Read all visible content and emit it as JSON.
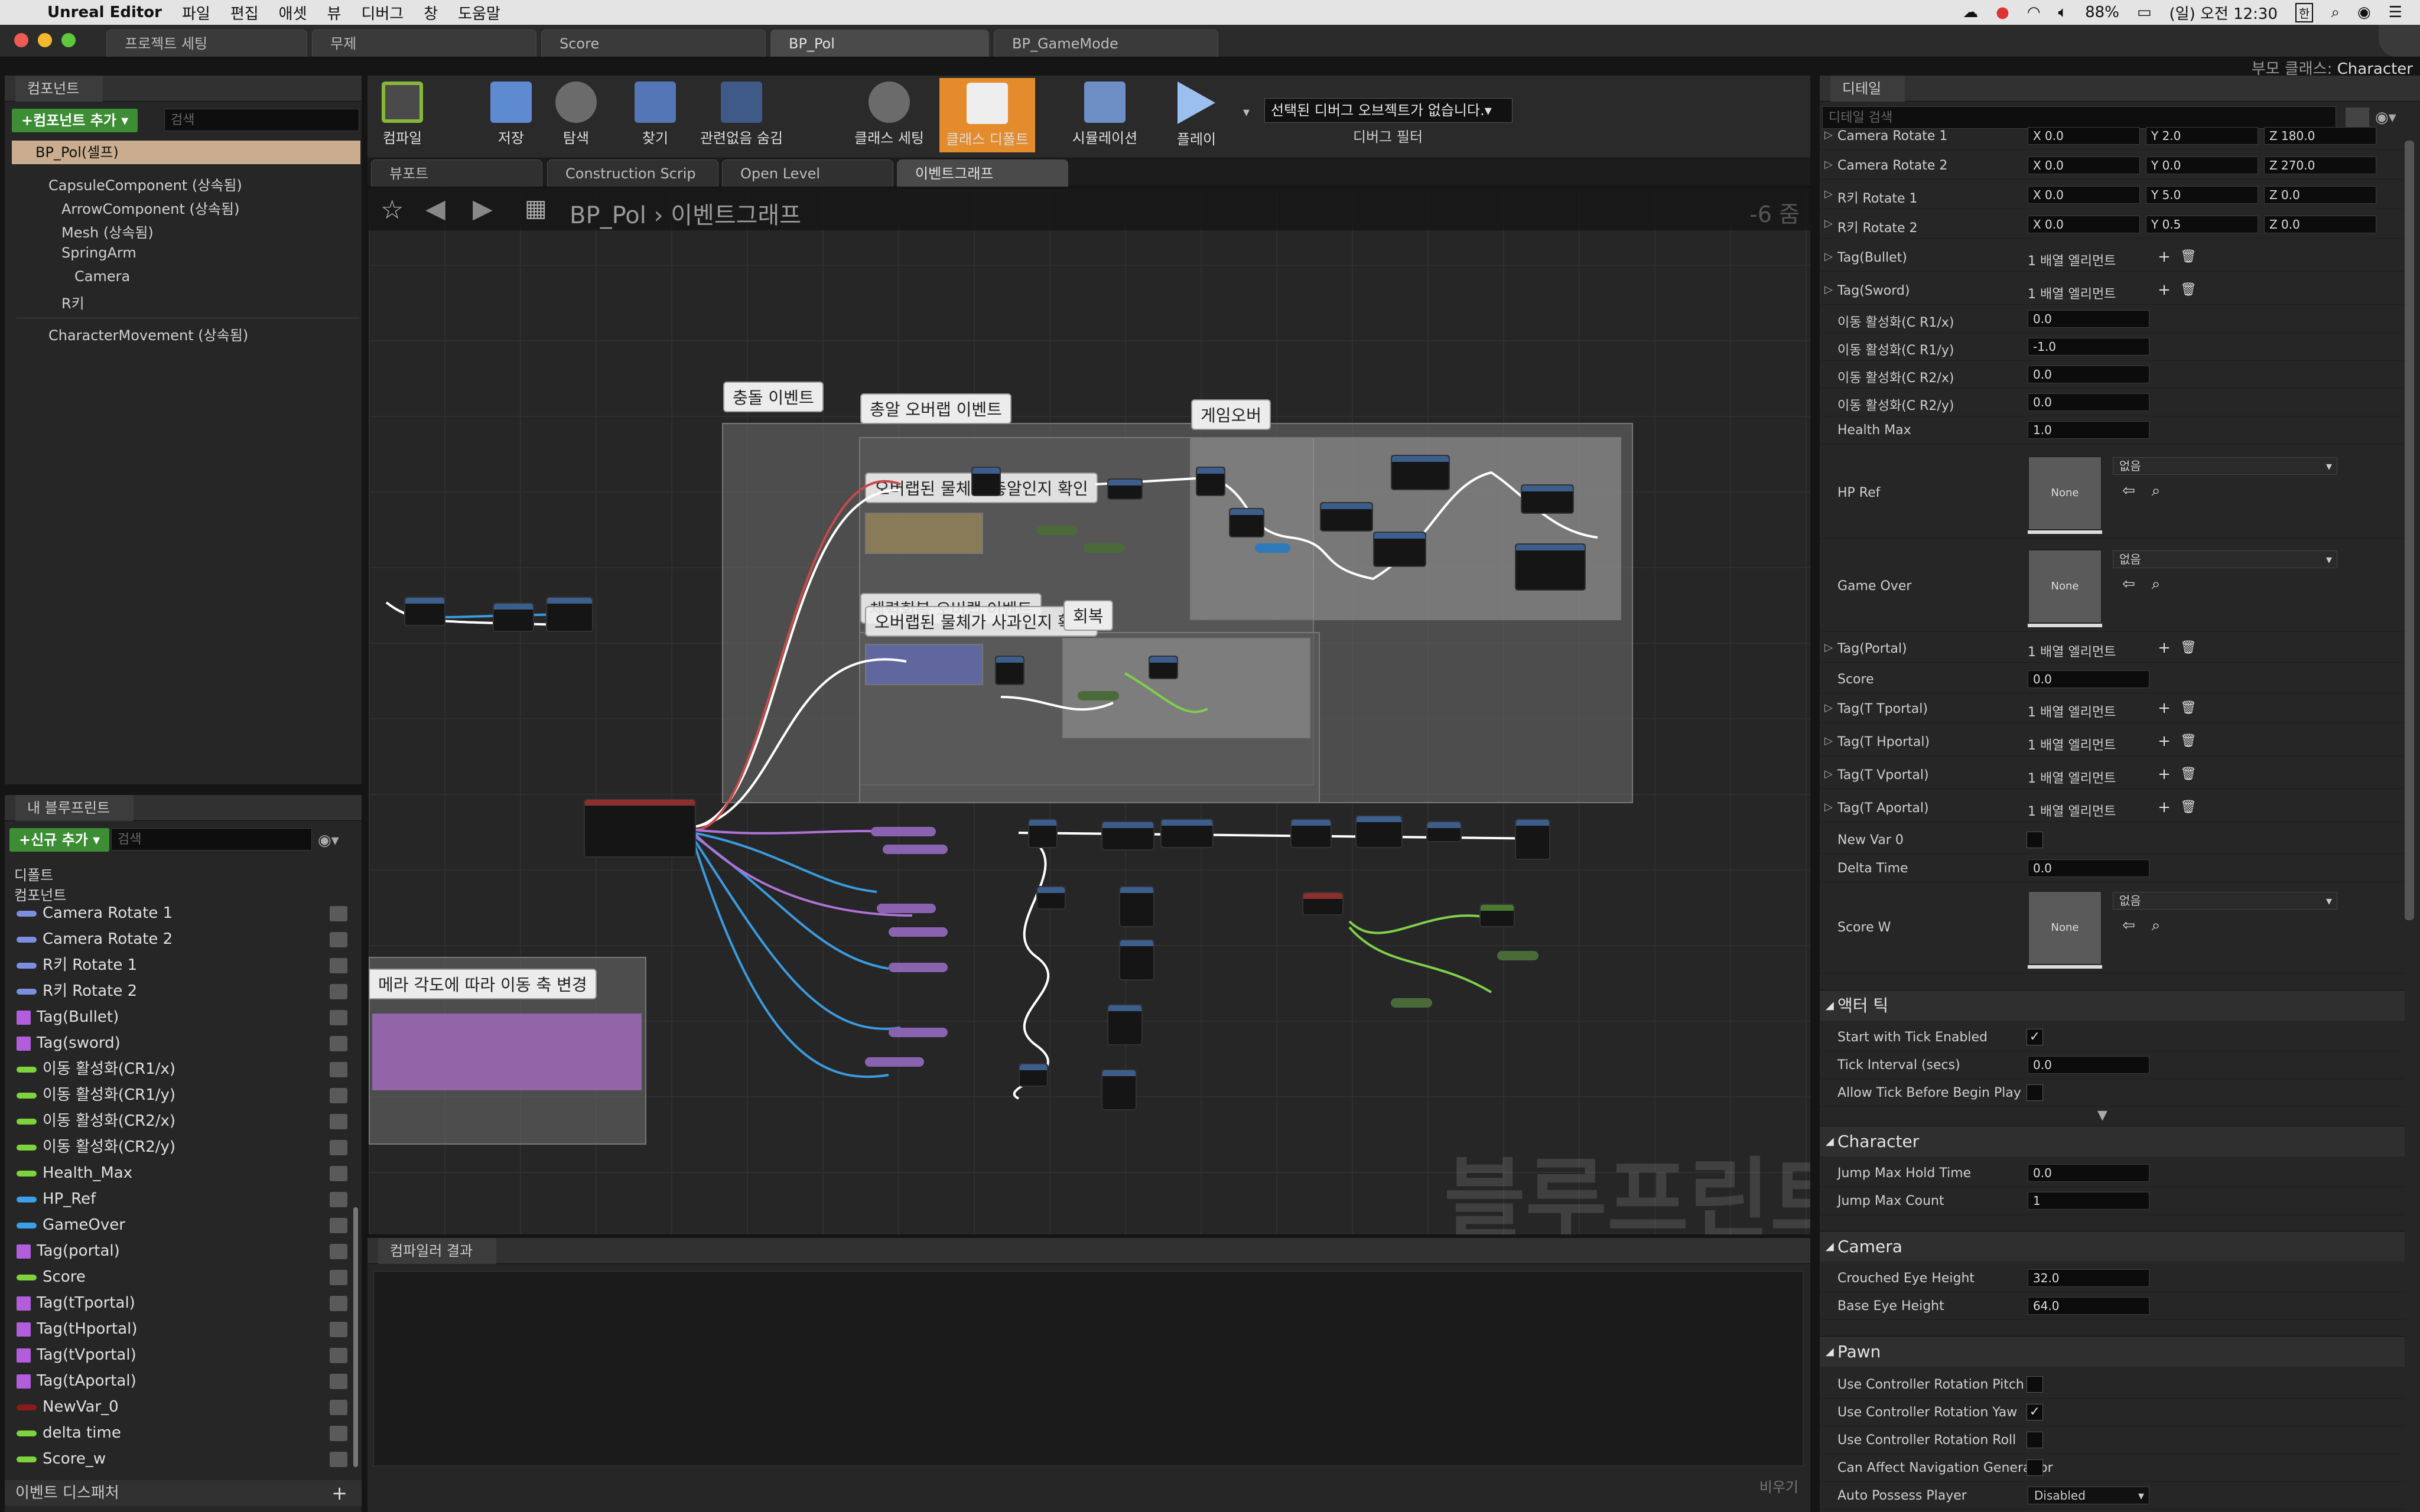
{
  "menubar": {
    "app": "Unreal Editor",
    "menus": [
      "파일",
      "편집",
      "애셋",
      "뷰",
      "디버그",
      "창",
      "도움말"
    ],
    "battery": "88%",
    "clock": "(일) 오전 12:30",
    "ime": "한"
  },
  "tabs": [
    "프로젝트 세팅",
    "무제",
    "Score",
    "BP_Pol",
    "BP_GameMode"
  ],
  "parent_class": {
    "label": "부모 클래스:",
    "value": "Character"
  },
  "components": {
    "title": "컴포넌트",
    "add": "+컴포넌트 추가 ▾",
    "search_placeholder": "검색",
    "root": "BP_Pol(셀프)",
    "items": [
      "CapsuleComponent (상속됨)",
      "ArrowComponent (상속됨)",
      "Mesh (상속됨)",
      "SpringArm",
      "Camera",
      "R키",
      "CharacterMovement (상속됨)"
    ]
  },
  "myblueprint": {
    "title": "내 블루프린트",
    "add": "+신규 추가 ▾",
    "search_placeholder": "검색",
    "sec_default": "디폴트",
    "sec_components": "컴포넌트",
    "vars": [
      {
        "name": "Camera Rotate 1",
        "color": "#7b8fe0"
      },
      {
        "name": "Camera Rotate 2",
        "color": "#7b8fe0"
      },
      {
        "name": "R키 Rotate 1",
        "color": "#7b8fe0"
      },
      {
        "name": "R키 Rotate 2",
        "color": "#7b8fe0"
      },
      {
        "name": "Tag(Bullet)",
        "color": "#b15ddc"
      },
      {
        "name": "Tag(sword)",
        "color": "#b15ddc"
      },
      {
        "name": "이동 활성화(CR1/x)",
        "color": "#7dd33b"
      },
      {
        "name": "이동 활성화(CR1/y)",
        "color": "#7dd33b"
      },
      {
        "name": "이동 활성화(CR2/x)",
        "color": "#7dd33b"
      },
      {
        "name": "이동 활성화(CR2/y)",
        "color": "#7dd33b"
      },
      {
        "name": "Health_Max",
        "color": "#7dd33b"
      },
      {
        "name": "HP_Ref",
        "color": "#3aa0e8"
      },
      {
        "name": "GameOver",
        "color": "#3aa0e8"
      },
      {
        "name": "Tag(portal)",
        "color": "#b15ddc"
      },
      {
        "name": "Score",
        "color": "#7dd33b"
      },
      {
        "name": "Tag(tTportal)",
        "color": "#b15ddc"
      },
      {
        "name": "Tag(tHportal)",
        "color": "#b15ddc"
      },
      {
        "name": "Tag(tVportal)",
        "color": "#b15ddc"
      },
      {
        "name": "Tag(tAportal)",
        "color": "#b15ddc"
      },
      {
        "name": "NewVar_0",
        "color": "#8b1a1a"
      },
      {
        "name": "delta time",
        "color": "#7dd33b"
      },
      {
        "name": "Score_w",
        "color": "#7dd33b"
      }
    ],
    "dispatchers": "이벤트 디스패처"
  },
  "toolbar": {
    "buttons": [
      "컴파일",
      "저장",
      "탐색",
      "찾기",
      "관련없음 숨김",
      "클래스 세팅",
      "클래스 디폴트",
      "시뮬레이션",
      "플레이"
    ],
    "debug_select": "선택된 디버그 오브젝트가 없습니다.▾",
    "debug_filter": "디버그 필터"
  },
  "graph_tabs": [
    "뷰포트",
    "Construction Scrip",
    "Open Level",
    "이벤트그래프"
  ],
  "breadcrumb": {
    "bp": "BP_Pol",
    "sep": "›",
    "graph": "이벤트그래프"
  },
  "zoom": "-6 줌",
  "watermark": "블루프린트",
  "comments": [
    "충돌 이벤트",
    "총알 오버랩 이벤트",
    "게임오버",
    "오버랩된 물체가 총알인지 확인",
    "체력회복 오버랩 이벤트",
    "오버랩된 물체가 사과인지 확인",
    "회복",
    "메라 각도에 따라 이동 축 변경"
  ],
  "compiler": {
    "title": "컴파일러 결과",
    "clear": "비우기"
  },
  "details": {
    "title": "디테일",
    "search_placeholder": "디테일 검색",
    "rows_vec": [
      {
        "label": "Camera Rotate 1",
        "x": "X 0.0",
        "y": "Y 2.0",
        "z": "Z 180.0"
      },
      {
        "label": "Camera Rotate 2",
        "x": "X 0.0",
        "y": "Y 0.0",
        "z": "Z 270.0"
      },
      {
        "label": "R키 Rotate 1",
        "x": "X 0.0",
        "y": "Y 5.0",
        "z": "Z 0.0"
      },
      {
        "label": "R키 Rotate 2",
        "x": "X 0.0",
        "y": "Y 0.5",
        "z": "Z 0.0"
      }
    ],
    "array_label": "1 배열 엘리먼트",
    "rows_tag1": [
      "Tag(Bullet)",
      "Tag(Sword)"
    ],
    "rows_num": [
      {
        "label": "이동 활성화(C R1/x)",
        "value": "0.0"
      },
      {
        "label": "이동 활성화(C R1/y)",
        "value": "-1.0"
      },
      {
        "label": "이동 활성화(C R2/x)",
        "value": "0.0"
      },
      {
        "label": "이동 활성화(C R2/y)",
        "value": "0.0"
      },
      {
        "label": "Health Max",
        "value": "1.0"
      }
    ],
    "hp_ref": {
      "label": "HP Ref",
      "thumb": "None",
      "drop": "없음"
    },
    "game_over": {
      "label": "Game Over",
      "thumb": "None",
      "drop": "없음"
    },
    "tag_portal": "Tag(Portal)",
    "score": {
      "label": "Score",
      "value": "0.0"
    },
    "rows_tag2": [
      "Tag(T Tportal)",
      "Tag(T Hportal)",
      "Tag(T Vportal)",
      "Tag(T Aportal)"
    ],
    "newvar": "New Var 0",
    "delta": {
      "label": "Delta Time",
      "value": "0.0"
    },
    "score_w": {
      "label": "Score W",
      "thumb": "None",
      "drop": "없음"
    },
    "sec_actor": "액터 틱",
    "actor_rows": [
      {
        "label": "Start with Tick Enabled",
        "checked": "✓"
      },
      {
        "label": "Tick Interval (secs)",
        "value": "0.0"
      },
      {
        "label": "Allow Tick Before Begin Play",
        "checked": ""
      }
    ],
    "sec_character": "Character",
    "char_rows": [
      {
        "label": "Jump Max Hold Time",
        "value": "0.0"
      },
      {
        "label": "Jump Max Count",
        "value": "1"
      }
    ],
    "sec_camera": "Camera",
    "cam_rows": [
      {
        "label": "Crouched Eye Height",
        "value": "32.0"
      },
      {
        "label": "Base Eye Height",
        "value": "64.0"
      }
    ],
    "sec_pawn": "Pawn",
    "pawn_rows": [
      {
        "label": "Use Controller Rotation Pitch",
        "checked": ""
      },
      {
        "label": "Use Controller Rotation Yaw",
        "checked": "✓"
      },
      {
        "label": "Use Controller Rotation Roll",
        "checked": ""
      },
      {
        "label": "Can Affect Navigation Generatior",
        "checked": ""
      }
    ],
    "auto_possess": {
      "label": "Auto Possess Player",
      "value": "Disabled"
    }
  }
}
